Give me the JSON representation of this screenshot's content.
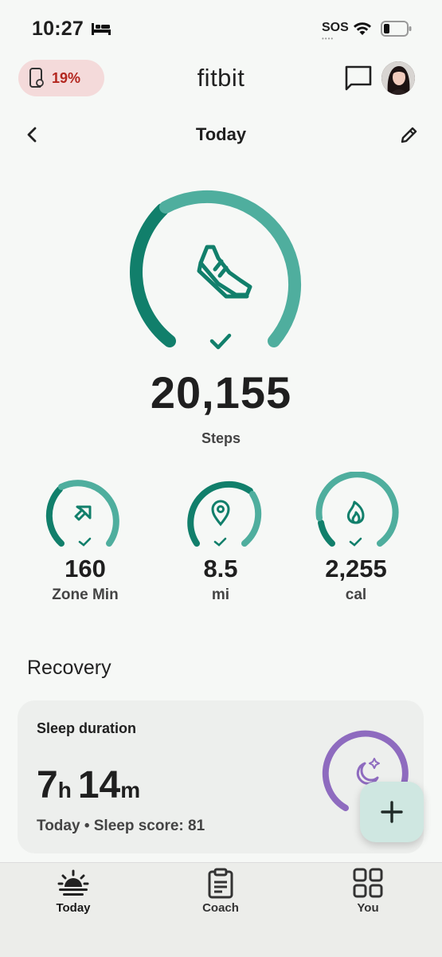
{
  "status_bar": {
    "time": "10:27",
    "carrier": "SOS",
    "sos_dots": "••••"
  },
  "header": {
    "device_battery": "19%",
    "title": "fitbit"
  },
  "date_row": {
    "title": "Today"
  },
  "steps": {
    "value": "20,155",
    "label": "Steps",
    "goal_progress": 1.0
  },
  "stats": [
    {
      "value": "160",
      "label": "Zone Min",
      "icon": "zone-minutes-icon"
    },
    {
      "value": "8.5",
      "label": "mi",
      "icon": "location-pin-icon"
    },
    {
      "value": "2,255",
      "label": "cal",
      "icon": "flame-icon"
    }
  ],
  "recovery": {
    "section_title": "Recovery",
    "card_title": "Sleep duration",
    "hours": "7",
    "hours_unit": "h",
    "minutes": "14",
    "minutes_unit": "m",
    "subtitle": "Today • Sleep score: 81"
  },
  "fab": {
    "label": "+"
  },
  "nav": [
    {
      "label": "Today",
      "active": true
    },
    {
      "label": "Coach",
      "active": false
    },
    {
      "label": "You",
      "active": false
    }
  ],
  "colors": {
    "ring_teal": "#4fae9e",
    "ring_teal_dark": "#117f6b",
    "sleep_purple": "#8e6bbf",
    "battery_red": "#b3261e"
  }
}
